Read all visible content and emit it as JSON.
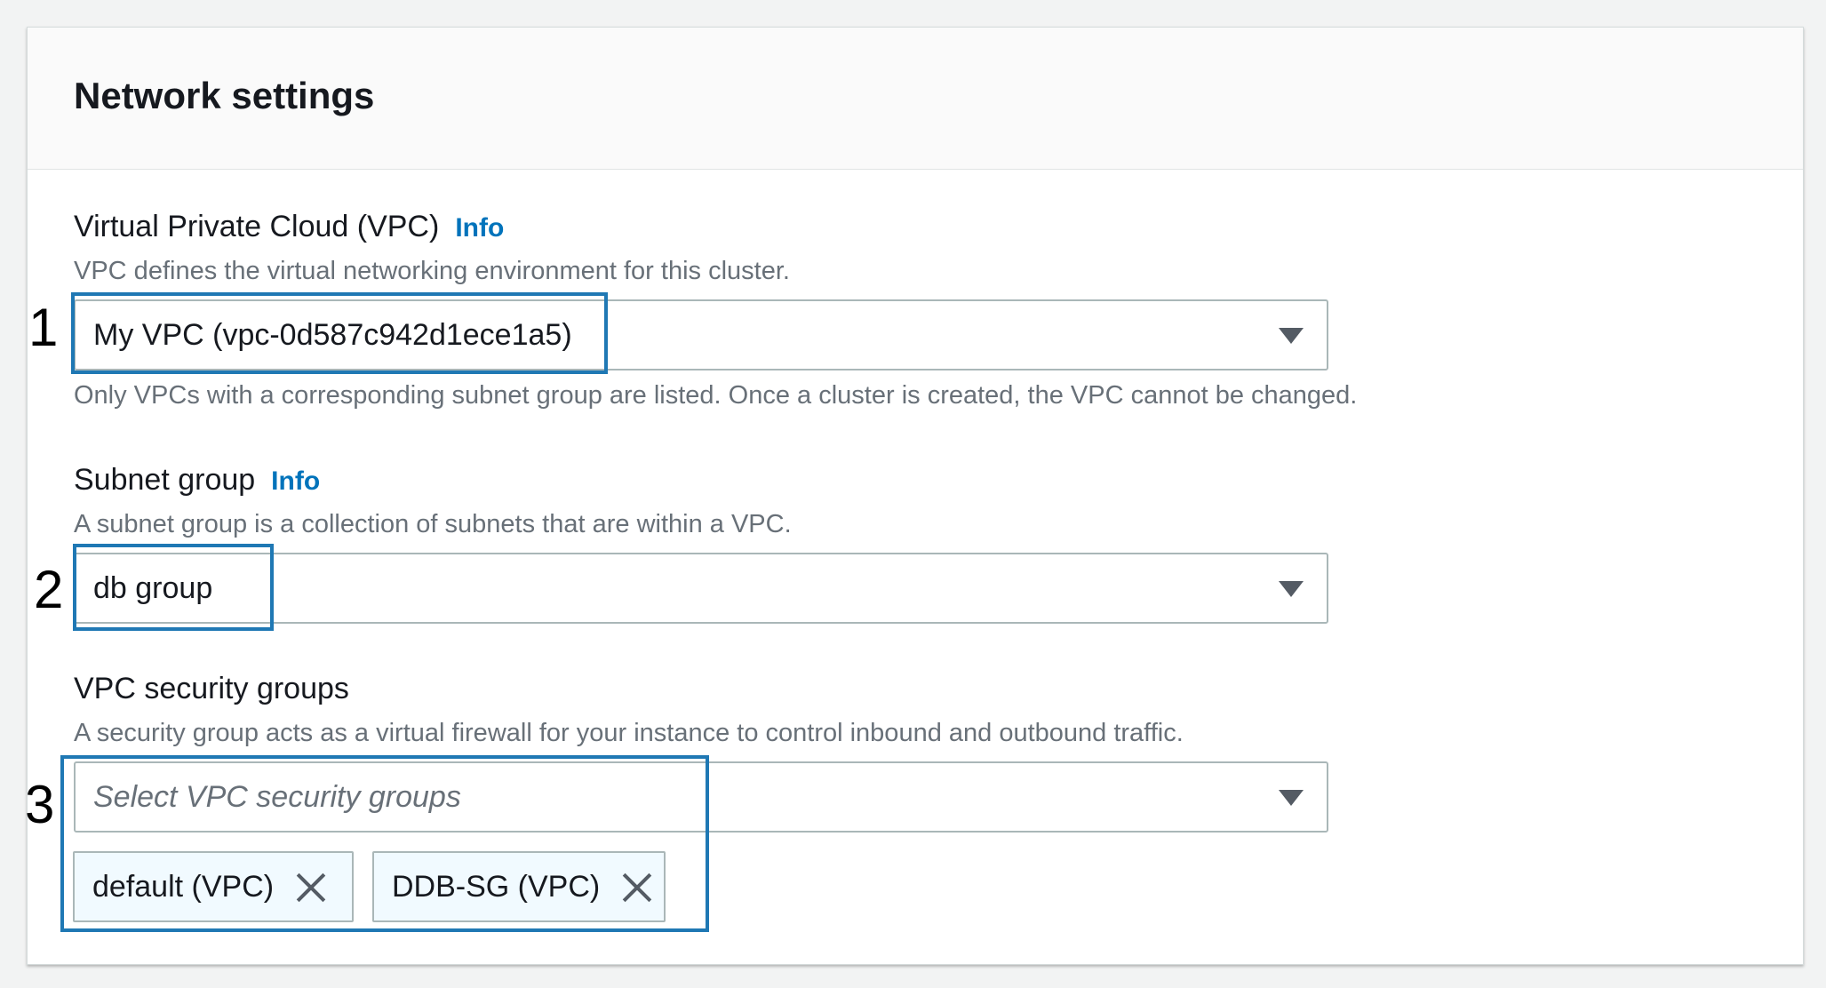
{
  "panel": {
    "title": "Network settings"
  },
  "vpc": {
    "label": "Virtual Private Cloud (VPC)",
    "info": "Info",
    "description": "VPC defines the virtual networking environment for this cluster.",
    "selected": "My VPC (vpc-0d587c942d1ece1a5)",
    "hint": "Only VPCs with a corresponding subnet group are listed. Once a cluster is created, the VPC cannot be changed."
  },
  "subnet": {
    "label": "Subnet group",
    "info": "Info",
    "description": "A subnet group is a collection of subnets that are within a VPC.",
    "selected": "db group"
  },
  "security_groups": {
    "label": "VPC security groups",
    "description": "A security group acts as a virtual firewall for your instance to control inbound and outbound traffic.",
    "placeholder": "Select VPC security groups",
    "tokens": [
      {
        "label": "default (VPC)"
      },
      {
        "label": "DDB-SG (VPC)"
      }
    ]
  },
  "annotations": {
    "step1": "1",
    "step2": "2",
    "step3": "3",
    "highlight_color": "#1f78b4"
  },
  "colors": {
    "link": "#0073bb",
    "token_background": "#f1faff",
    "description_text": "#687078"
  },
  "icons": {
    "dropdown": "caret-down-icon",
    "remove": "close-icon"
  }
}
